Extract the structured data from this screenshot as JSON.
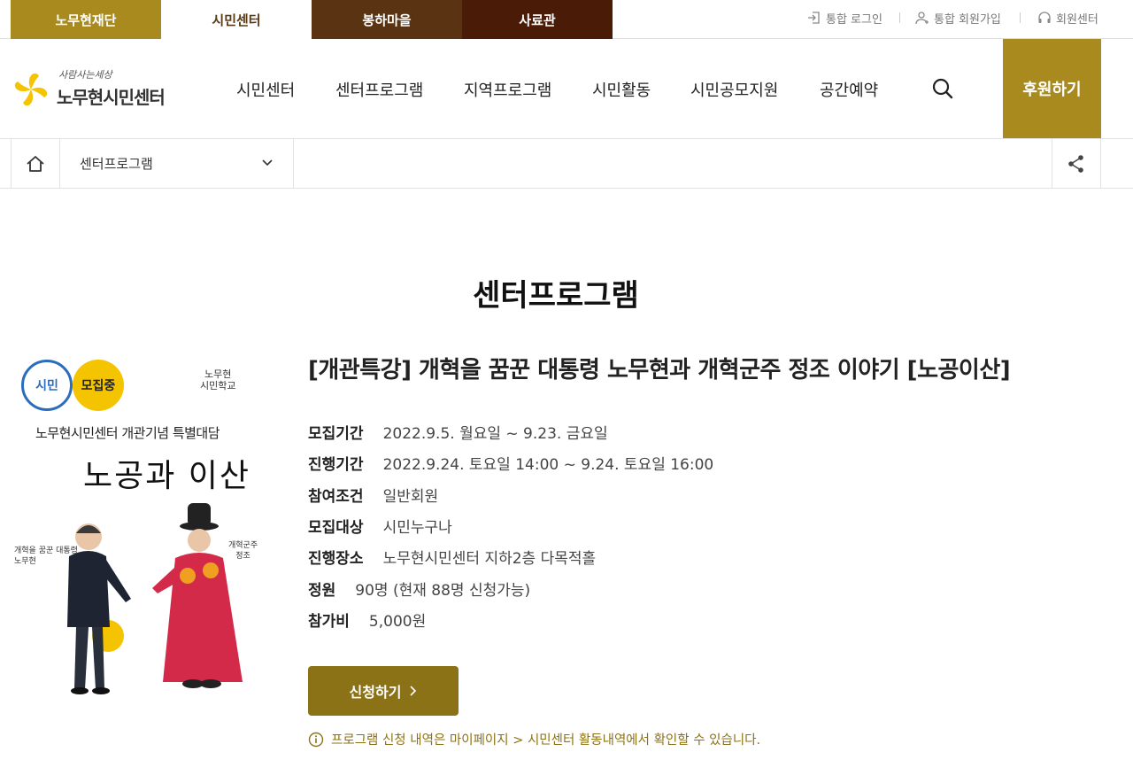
{
  "site_tabs": [
    "노무현재단",
    "시민센터",
    "봉하마을",
    "사료관"
  ],
  "util_links": [
    "통합 로그인",
    "통합 회원가입",
    "회원센터"
  ],
  "logo": {
    "tagline": "사람사는세상",
    "name": "노무현시민센터"
  },
  "gnb": [
    "시민센터",
    "센터프로그램",
    "지역프로그램",
    "시민활동",
    "시민공모지원",
    "공간예약"
  ],
  "donate_label": "후원하기",
  "location": {
    "current": "센터프로그램"
  },
  "page_title": "센터프로그램",
  "poster": {
    "badge_citizen": "시민",
    "badge_status": "모집중",
    "school_line1": "노무현",
    "school_line2": "시민학교",
    "headline": "노무현시민센터 개관기념 특별대담",
    "title": "노공과 이산",
    "left_caption_line1": "개혁을 꿈꾼 대통령",
    "left_caption_line2": "노무현",
    "right_caption_line1": "개혁군주",
    "right_caption_line2": "정조"
  },
  "program": {
    "title": "[개관특강] 개혁을 꿈꾼 대통령 노무현과 개혁군주 정조 이야기 [노공이산]",
    "details": [
      {
        "label": "모집기간",
        "value": "2022.9.5. 월요일 ~ 9.23. 금요일"
      },
      {
        "label": "진행기간",
        "value": "2022.9.24. 토요일 14:00 ~ 9.24. 토요일 16:00"
      },
      {
        "label": "참여조건",
        "value": "일반회원"
      },
      {
        "label": "모집대상",
        "value": "시민누구나"
      },
      {
        "label": "진행장소",
        "value": "노무현시민센터 지하2층 다목적홀"
      },
      {
        "label": "정원",
        "value": "90명 (현재 88명 신청가능)"
      },
      {
        "label": "참가비",
        "value": "5,000원"
      }
    ],
    "apply_label": "신청하기",
    "notice": "프로그램 신청 내역은 마이페이지 > 시민센터 활동내역에서 확인할 수 있습니다."
  },
  "colors": {
    "brand_gold": "#a88a1e",
    "apply_button": "#8c7216",
    "brown": "#5a3412",
    "dark_brown": "#4a1c08"
  }
}
